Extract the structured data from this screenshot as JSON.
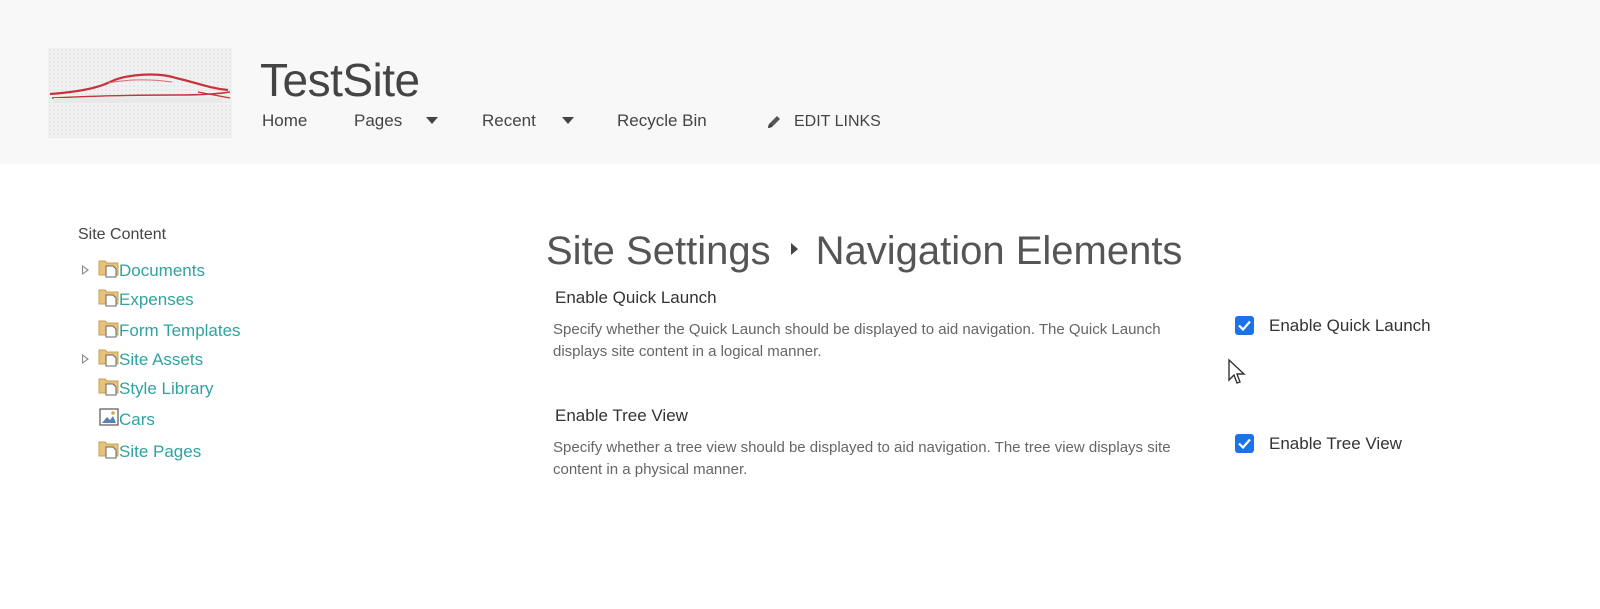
{
  "header": {
    "site_title": "TestSite",
    "logo_icon": "car-logo-icon",
    "nav": {
      "home": "Home",
      "pages": "Pages",
      "recent": "Recent",
      "recycle_bin": "Recycle Bin",
      "edit_links": "EDIT LINKS"
    }
  },
  "tree": {
    "title": "Site Content",
    "items": [
      {
        "label": "Documents",
        "icon": "folder-icon",
        "expandable": true
      },
      {
        "label": "Expenses",
        "icon": "folder-icon",
        "expandable": false
      },
      {
        "label": "Form Templates",
        "icon": "folder-icon",
        "expandable": false
      },
      {
        "label": "Site Assets",
        "icon": "folder-icon",
        "expandable": true
      },
      {
        "label": "Style Library",
        "icon": "folder-icon",
        "expandable": false
      },
      {
        "label": "Cars",
        "icon": "picture-library-icon",
        "expandable": false
      },
      {
        "label": "Site Pages",
        "icon": "folder-icon",
        "expandable": false
      }
    ]
  },
  "main": {
    "breadcrumb_root": "Site Settings",
    "breadcrumb_current": "Navigation Elements",
    "sections": [
      {
        "title": "Enable Quick Launch",
        "description": "Specify whether the Quick Launch should be displayed to aid navigation.  The Quick Launch displays site content in a logical manner.",
        "checkbox_label": "Enable Quick Launch",
        "checked": true
      },
      {
        "title": "Enable Tree View",
        "description": "Specify whether a tree view should be displayed to aid navigation.  The tree view displays site content in a physical manner.",
        "checkbox_label": "Enable Tree View",
        "checked": true
      }
    ]
  },
  "colors": {
    "header_bg": "#f8f8f8",
    "link": "#2ea3a0",
    "checkbox": "#1a73e8",
    "logo_accent": "#c8323c"
  }
}
